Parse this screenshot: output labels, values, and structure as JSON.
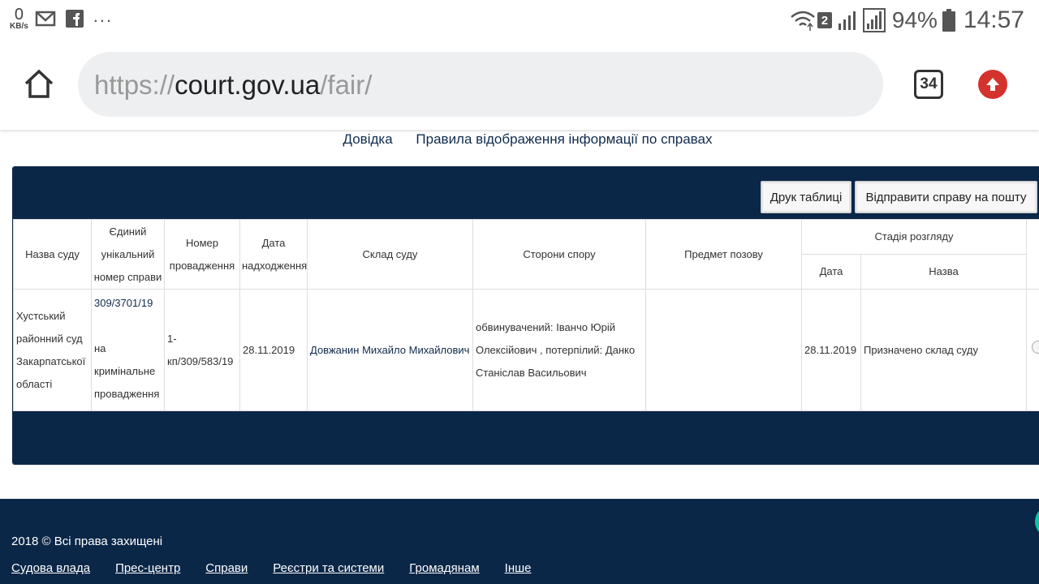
{
  "status_bar": {
    "net_speed_value": "0",
    "net_speed_unit": "KB/s",
    "dots": "...",
    "sim_slot": "2",
    "battery_pct": "94%",
    "time": "14:57"
  },
  "browser": {
    "url_scheme": "https://",
    "url_host": "court.gov.ua",
    "url_path": "/fair/",
    "tab_count": "34"
  },
  "top_links": {
    "help": "Довідка",
    "rules": "Правила відображення інформації по справах"
  },
  "panel": {
    "print_label": "Друк таблиці",
    "send_label": "Відправити справу на пошту"
  },
  "table": {
    "headers": {
      "court_name": "Назва суду",
      "case_number": "Єдиний унікальний номер справи",
      "proceeding_number": "Номер провадження",
      "received_date": "Дата надходження",
      "court_panel": "Склад суду",
      "parties": "Сторони спору",
      "subject": "Предмет позову",
      "stage": "Стадія розгляду",
      "stage_date": "Дата",
      "stage_name": "Назва"
    },
    "rows": [
      {
        "court_name": "Хустський районний суд Закарпатської області",
        "case_number": "309/3701/19",
        "case_type": "на кримінальне провадження",
        "proceeding_number": "1-кп/309/583/19",
        "received_date": "28.11.2019",
        "court_panel": "Довжанин Михайло Михайлович",
        "parties": "обвинувачений: Іванчо Юрій Олексійович , потерпілий: Данко Станіслав Васильович",
        "subject": "",
        "stage_date": "28.11.2019",
        "stage_name": "Призначено склад суду"
      }
    ]
  },
  "footer": {
    "copyright": "2018 © Всі права захищені",
    "nav": [
      "Судова влада",
      "Прес-центр",
      "Справи",
      "Реєстри та системи",
      "Громадянам",
      "Інше"
    ]
  }
}
